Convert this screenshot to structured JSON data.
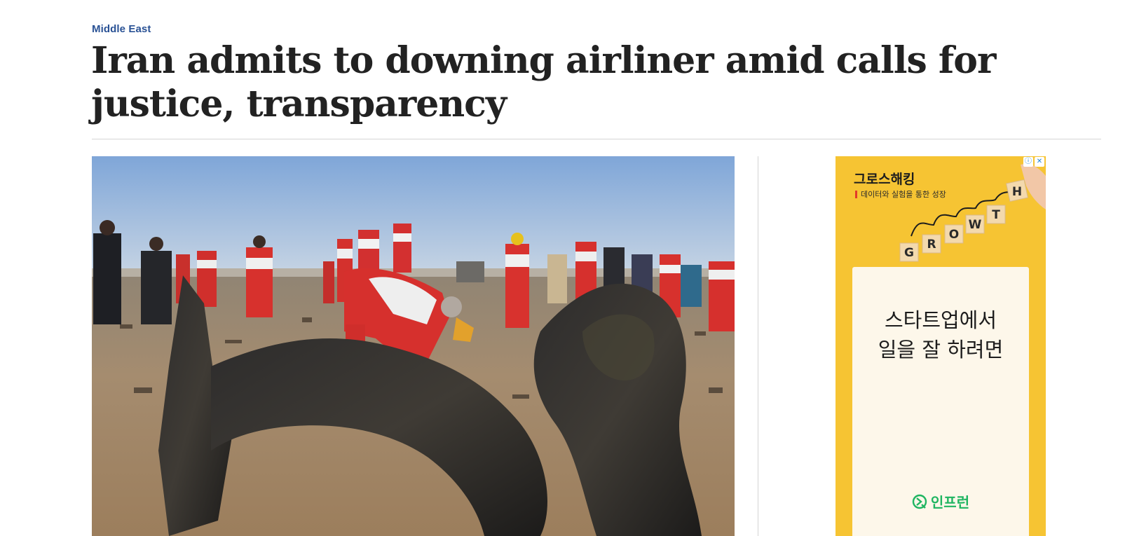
{
  "article": {
    "section": "Middle East",
    "headline": "Iran admits to downing airliner amid calls for justice, transparency"
  },
  "ad": {
    "brand": "그로스해킹",
    "tagline": "데이터와 실험을 통한 성장",
    "growth_letters": [
      "G",
      "R",
      "O",
      "W",
      "T",
      "H"
    ],
    "headline": "스타트업에서\n일을 잘 하려면",
    "advertiser": "인프런",
    "info_glyph": "ⓘ",
    "close_glyph": "✕",
    "colors": {
      "background": "#f6c433",
      "card": "#fdf7ea",
      "logo": "#1fb561"
    }
  },
  "colors": {
    "section_link": "#2a5295",
    "headline": "#222222",
    "rule": "#d5d5d5"
  }
}
